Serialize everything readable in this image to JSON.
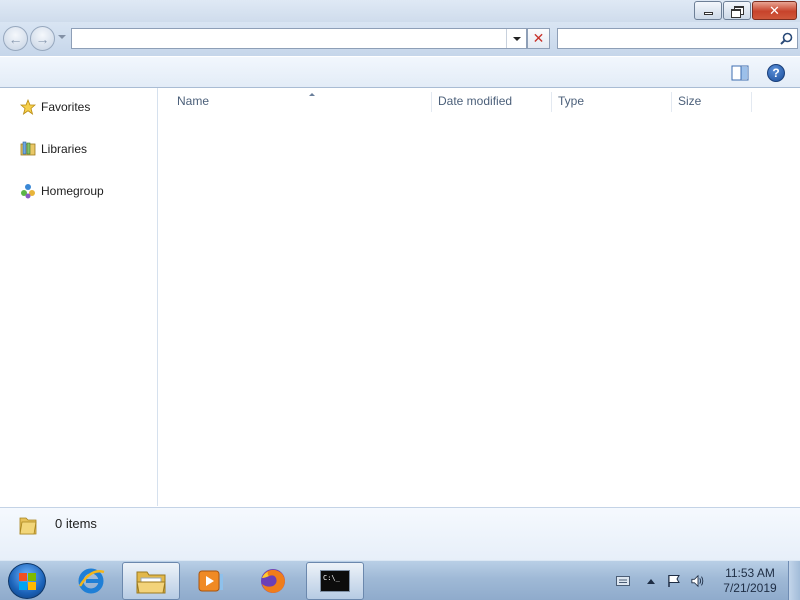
{
  "window": {
    "caption": {
      "minimize": "minimize",
      "maximize": "restore",
      "close": "✕"
    }
  },
  "addressbar": {
    "address_value": "",
    "search_value": "",
    "stop_glyph": "✕"
  },
  "commandbar": {
    "help_glyph": "?"
  },
  "navigation_pane": {
    "items": [
      {
        "label": "Favorites",
        "icon": "star-icon"
      },
      {
        "label": "Libraries",
        "icon": "libraries-icon"
      },
      {
        "label": "Homegroup",
        "icon": "homegroup-icon"
      }
    ]
  },
  "file_list": {
    "columns": [
      {
        "label": "Name",
        "sorted": true
      },
      {
        "label": "Date modified"
      },
      {
        "label": "Type"
      },
      {
        "label": "Size"
      }
    ],
    "rows": []
  },
  "details_pane": {
    "status": "0 items"
  },
  "taskbar": {
    "apps": [
      {
        "name": "internet-explorer",
        "active": false
      },
      {
        "name": "windows-explorer",
        "active": true
      },
      {
        "name": "windows-media-player",
        "active": false
      },
      {
        "name": "firefox",
        "active": false
      },
      {
        "name": "command-prompt",
        "active": false,
        "label": "C:\\_"
      }
    ],
    "clock_time": "11:53 AM",
    "clock_date": "7/21/2019"
  },
  "colors": {
    "accent": "#1b62b8",
    "close_button": "#c7432b",
    "column_header_text": "#4c607a"
  }
}
